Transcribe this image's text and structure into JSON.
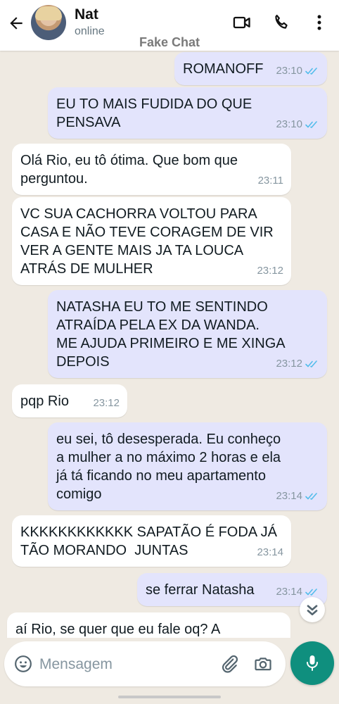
{
  "header": {
    "contact_name": "Nat",
    "status": "online",
    "watermark": "Fake Chat",
    "icons": [
      "back-arrow-icon",
      "avatar",
      "video-call-icon",
      "phone-icon",
      "more-vert-icon"
    ]
  },
  "messages": [
    {
      "dir": "out",
      "text": "ROMANOFF",
      "time": "23:10",
      "read": true
    },
    {
      "dir": "out",
      "text": "EU TO MAIS FUDIDA DO QUE\nPENSAVA",
      "time": "23:10",
      "read": true
    },
    {
      "dir": "in",
      "text": "Olá Rio, eu tô ótima. Que bom que\nperguntou.",
      "time": "23:11"
    },
    {
      "dir": "in",
      "text": "VC SUA CACHORRA VOLTOU PARA\nCASA E NÃO TEVE CORAGEM DE VIR\nVER A GENTE MAIS JA TA LOUCA\nATRÁS DE MULHER",
      "time": "23:12"
    },
    {
      "dir": "out",
      "text": "NATASHA EU TO ME SENTINDO\nATRAÍDA PELA EX DA WANDA.\nME AJUDA PRIMEIRO E ME XINGA\nDEPOIS",
      "time": "23:12",
      "read": true
    },
    {
      "dir": "in",
      "text": "pqp Rio",
      "time": "23:12"
    },
    {
      "dir": "out",
      "text": "eu sei, tô desesperada. Eu conheço\na mulher a no máximo 2 horas e ela\njá tá ficando no meu apartamento\ncomigo",
      "time": "23:14",
      "read": true
    },
    {
      "dir": "in",
      "text": "KKKKKKKKKKKK SAPATÃO É FODA JÁ\nTÃO MORANDO  JUNTAS",
      "time": "23:14"
    },
    {
      "dir": "out",
      "text": "se ferrar Natasha",
      "time": "23:14",
      "read": true
    },
    {
      "dir": "in",
      "text": "aí Rio, se quer que eu fale oq? A",
      "time": ""
    }
  ],
  "composer": {
    "placeholder": "Mensagem",
    "icons": [
      "emoji-icon",
      "attach-icon",
      "camera-icon",
      "mic-icon"
    ]
  },
  "colors": {
    "chat_background": "#efeae2",
    "incoming_bubble": "#ffffff",
    "outgoing_bubble": "#e3e4fc",
    "read_ticks": "#53bdeb",
    "mic_button": "#0f8f7e"
  }
}
